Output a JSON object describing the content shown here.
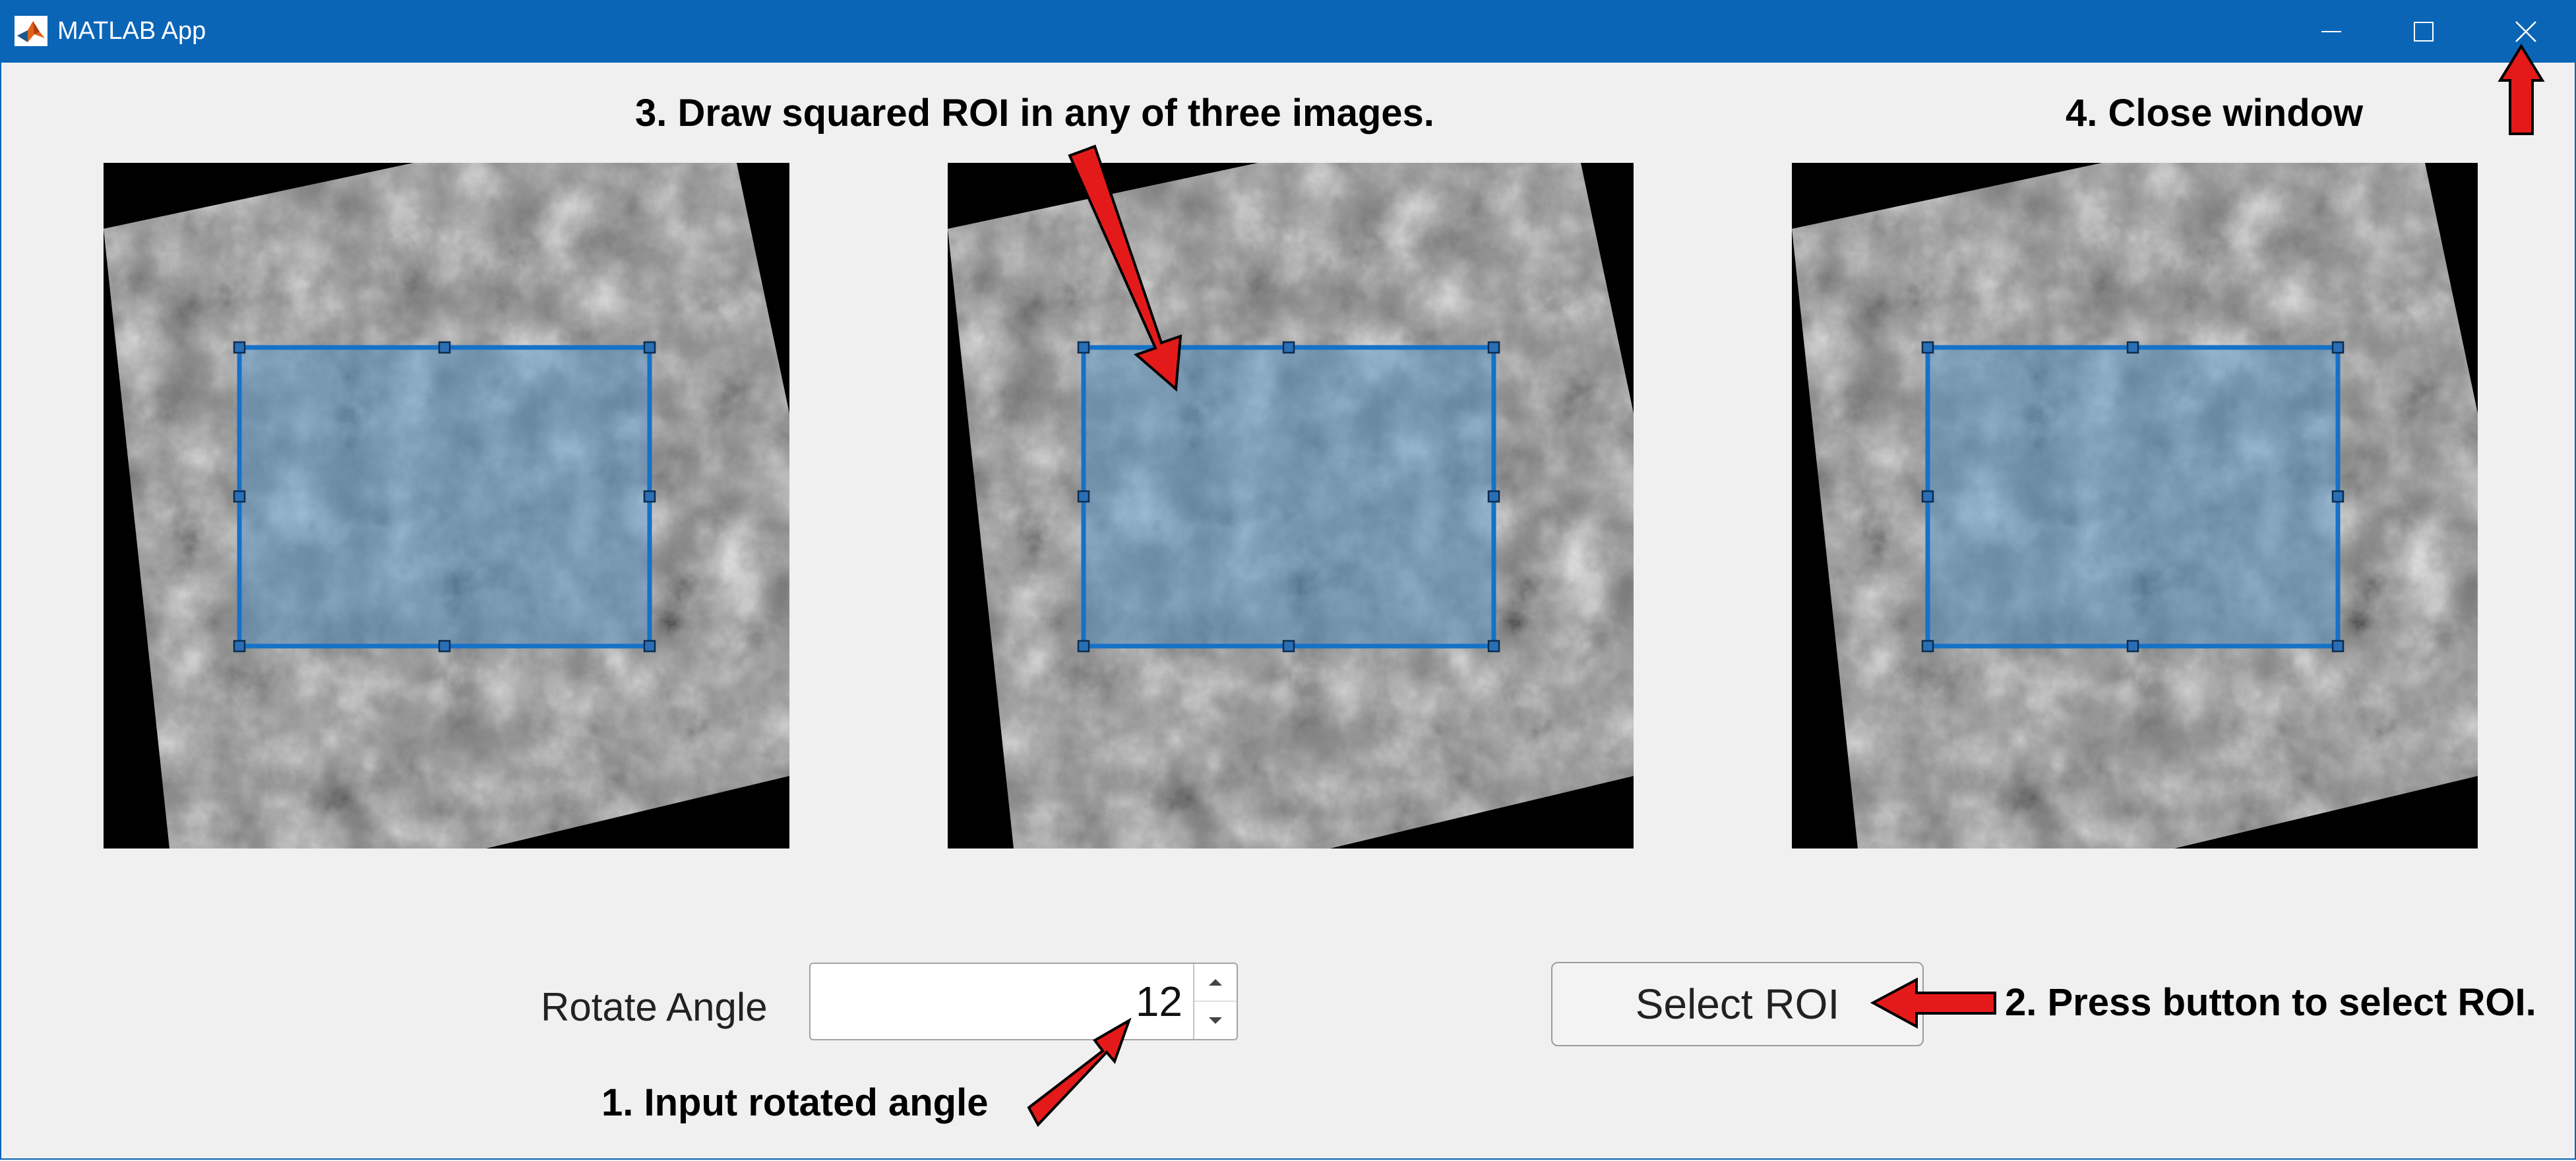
{
  "window": {
    "title": "MATLAB App",
    "icon": "matlab-logo-icon",
    "controls": [
      "minimize-icon",
      "maximize-icon",
      "close-icon"
    ]
  },
  "annotations": {
    "step3": "3. Draw squared ROI in any of three images.",
    "step4": "4. Close window",
    "step1": "1. Input rotated angle",
    "step2": "2. Press button to select ROI."
  },
  "controls": {
    "rotate_label": "Rotate Angle",
    "rotate_value": "12",
    "select_roi_label": "Select ROI"
  },
  "colors": {
    "titlebar": "#0a65b7",
    "roi_stroke": "#1671c8",
    "roi_fill": "#4a8fc7",
    "arrow": "#e41a1a"
  }
}
